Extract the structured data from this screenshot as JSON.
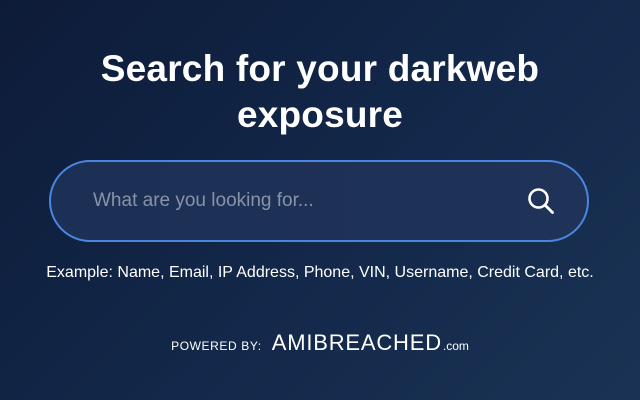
{
  "hero": {
    "title_line1": "Search for your darkweb",
    "title_line2": "exposure"
  },
  "search": {
    "value": "",
    "placeholder": "What are you looking for...",
    "button_icon": "search-icon"
  },
  "example": {
    "text": "Example: Name, Email, IP Address, Phone, VIN, Username, Credit Card, etc."
  },
  "footer": {
    "powered_label": "POWERED BY:",
    "brand_name": "AMIBREACHED",
    "brand_tld": ".com"
  },
  "colors": {
    "background": "#0d1b38",
    "accent_border": "#4a86e0",
    "text": "#ffffff",
    "placeholder": "#8893a8"
  }
}
